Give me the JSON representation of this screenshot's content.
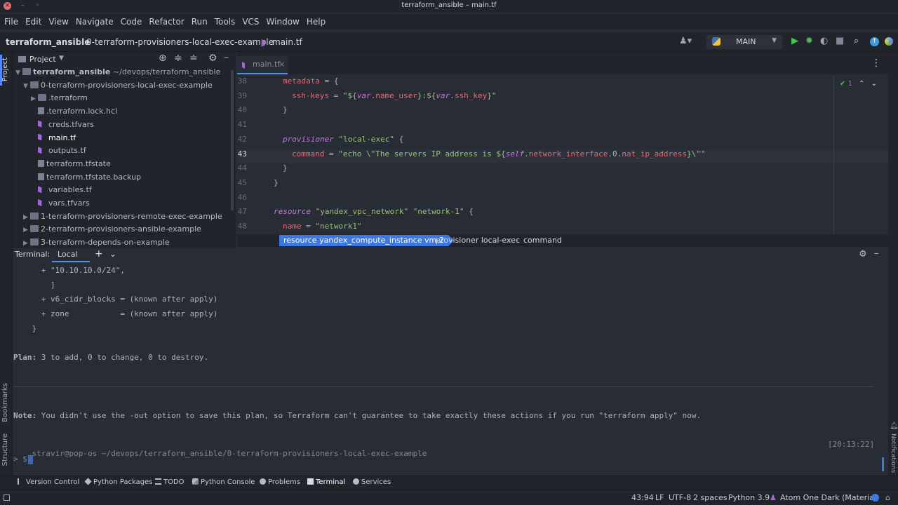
{
  "window": {
    "title": "terraform_ansible – main.tf"
  },
  "menu": [
    "File",
    "Edit",
    "View",
    "Navigate",
    "Code",
    "Refactor",
    "Run",
    "Tools",
    "VCS",
    "Window",
    "Help"
  ],
  "navbar": {
    "project": "terraform_ansible",
    "folder": "0-terraform-provisioners-local-exec-example",
    "file": "main.tf",
    "run_config": "MAIN"
  },
  "project_panel": {
    "title": "Project",
    "tree": [
      {
        "label": "terraform_ansible",
        "path": " ~/devops/terraform_ansible",
        "type": "folder",
        "level": 0,
        "open": true,
        "bold": true
      },
      {
        "label": "0-terraform-provisioners-local-exec-example",
        "type": "folder",
        "level": 1,
        "open": true
      },
      {
        "label": ".terraform",
        "type": "folder",
        "level": 2,
        "open": false
      },
      {
        "label": ".terraform.lock.hcl",
        "type": "file",
        "level": 2
      },
      {
        "label": "creds.tfvars",
        "type": "tf",
        "level": 2
      },
      {
        "label": "main.tf",
        "type": "tf",
        "level": 2,
        "selected": true
      },
      {
        "label": "outputs.tf",
        "type": "tf",
        "level": 2
      },
      {
        "label": "terraform.tfstate",
        "type": "file",
        "level": 2
      },
      {
        "label": "terraform.tfstate.backup",
        "type": "file",
        "level": 2
      },
      {
        "label": "variables.tf",
        "type": "tf",
        "level": 2
      },
      {
        "label": "vars.tfvars",
        "type": "tf",
        "level": 2
      },
      {
        "label": "1-terraform-provisioners-remote-exec-example",
        "type": "folder",
        "level": 1,
        "open": false
      },
      {
        "label": "2-terraform-provisioners-ansible-example",
        "type": "folder",
        "level": 1,
        "open": false
      },
      {
        "label": "3-terraform-depends-on-example",
        "type": "folder",
        "level": 1,
        "open": false
      }
    ]
  },
  "side_labels": {
    "project": "Project",
    "bookmarks": "Bookmarks",
    "structure": "Structure",
    "notifications": "Notifications"
  },
  "editor": {
    "tab": "main.tf",
    "inspection_count": "1",
    "lines": [
      {
        "num": "38",
        "indent": 1,
        "tokens": [
          [
            "key",
            "metadata"
          ],
          [
            "punc",
            " = {"
          ]
        ]
      },
      {
        "num": "39",
        "indent": 2,
        "tokens": [
          [
            "key",
            "ssh-keys"
          ],
          [
            "punc",
            " = "
          ],
          [
            "str",
            "\"${"
          ],
          [
            "vr",
            "var"
          ],
          [
            "punc",
            "."
          ],
          [
            "prop",
            "name_user"
          ],
          [
            "str",
            "}:${"
          ],
          [
            "vr",
            "var"
          ],
          [
            "punc",
            "."
          ],
          [
            "prop",
            "ssh_key"
          ],
          [
            "str",
            "}\""
          ]
        ]
      },
      {
        "num": "40",
        "indent": 1,
        "tokens": [
          [
            "punc",
            "}"
          ]
        ]
      },
      {
        "num": "41",
        "indent": 0,
        "tokens": []
      },
      {
        "num": "42",
        "indent": 1,
        "tokens": [
          [
            "kw",
            "provisioner"
          ],
          [
            "punc",
            " "
          ],
          [
            "str",
            "\"local-exec\""
          ],
          [
            "punc",
            " {"
          ]
        ]
      },
      {
        "num": "43",
        "indent": 2,
        "current": true,
        "tokens": [
          [
            "key",
            "command"
          ],
          [
            "punc",
            " = "
          ],
          [
            "str",
            "\"echo \\\"The servers IP address is ${"
          ],
          [
            "vr",
            "self"
          ],
          [
            "punc",
            "."
          ],
          [
            "prop",
            "network_interface"
          ],
          [
            "punc",
            ".0."
          ],
          [
            "prop",
            "nat_ip_address"
          ],
          [
            "str",
            "}\\\"\""
          ]
        ]
      },
      {
        "num": "44",
        "indent": 1,
        "tokens": [
          [
            "punc",
            "}"
          ]
        ]
      },
      {
        "num": "45",
        "indent": 0,
        "tokens": [
          [
            "punc",
            "}"
          ]
        ]
      },
      {
        "num": "46",
        "indent": 0,
        "tokens": []
      },
      {
        "num": "47",
        "indent": 0,
        "tokens": [
          [
            "kw",
            "resource"
          ],
          [
            "punc",
            " "
          ],
          [
            "str",
            "\"yandex_vpc_network\""
          ],
          [
            "punc",
            " "
          ],
          [
            "str",
            "\"network-1\""
          ],
          [
            "punc",
            " {"
          ]
        ]
      },
      {
        "num": "48",
        "indent": 1,
        "tokens": [
          [
            "key",
            "name"
          ],
          [
            "punc",
            " = "
          ],
          [
            "str",
            "\"network1\""
          ]
        ]
      }
    ]
  },
  "code_breadcrumbs": {
    "resource": "resource yandex_compute_instance vm-2",
    "provisioner": "provisioner local-exec",
    "command": "command"
  },
  "terminal": {
    "title": "Terminal:",
    "tab": "Local",
    "lines": [
      {
        "text": "      + \"10.10.10.0/24\",",
        "color": "#abb2bf"
      },
      {
        "text": "        ]",
        "color": "#abb2bf"
      },
      {
        "text": "      + v6_cidr_blocks = (known after apply)",
        "color": "#abb2bf"
      },
      {
        "text": "      + zone           = (known after apply)",
        "color": "#abb2bf"
      },
      {
        "text": "    }",
        "color": "#abb2bf"
      },
      {
        "text": "",
        "color": "#abb2bf"
      },
      {
        "text": "Plan: 3 to add, 0 to change, 0 to destroy.",
        "color": "#abb2bf",
        "bold_prefix": "Plan:"
      },
      {
        "text": "",
        "color": "#abb2bf"
      },
      {
        "text": "",
        "color": "#abb2bf"
      },
      {
        "text": "",
        "color": "#abb2bf"
      },
      {
        "text": "Note: You didn't use the -out option to save this plan, so Terraform can't guarantee to take exactly these actions if you run \"terraform apply\" now.",
        "color": "#abb2bf",
        "bold_prefix": "Note:"
      }
    ],
    "prompt_user": "stravir@pop-os",
    "prompt_path": " ~/devops/terraform_ansible/0-terraform-provisioners-local-exec-example",
    "prompt_time": "[20:13:22]",
    "prompt_symbol": "> $"
  },
  "bottom_tabs": [
    "Version Control",
    "Python Packages",
    "TODO",
    "Python Console",
    "Problems",
    "Terminal",
    "Services"
  ],
  "status": {
    "position": "43:94",
    "line_sep": "LF",
    "encoding": "UTF-8",
    "indent": "2 spaces",
    "interpreter": "Python 3.9",
    "theme": "Atom One Dark (Material)"
  },
  "colors": {
    "accent": "#3d78e0",
    "run": "#4fc14f",
    "background": "#282c34",
    "panel": "#21252b"
  }
}
